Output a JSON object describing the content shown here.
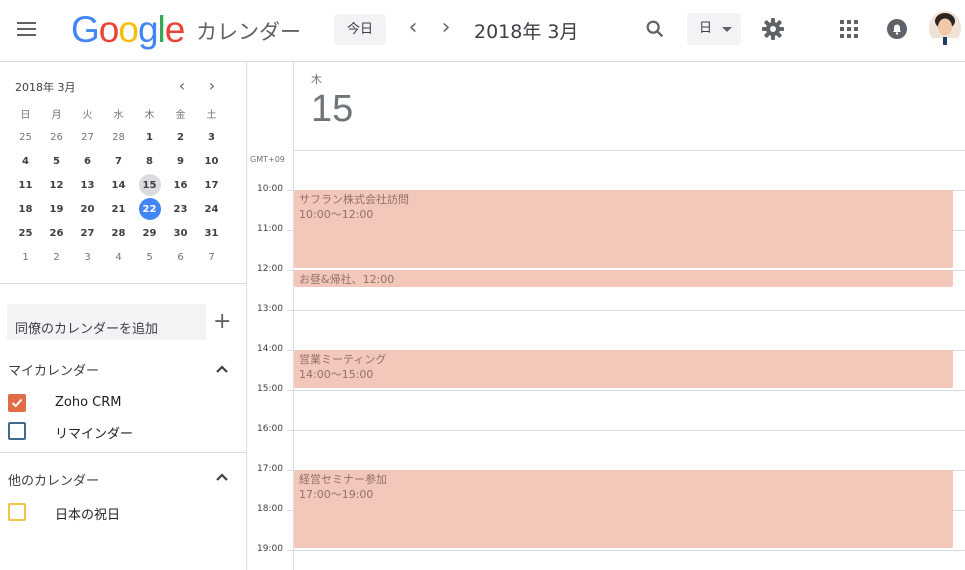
{
  "header": {
    "app_name": "カレンダー",
    "logo_text": "Google",
    "today_button": "今日",
    "current_period": "2018年 3月",
    "view_selector": "日",
    "icons": [
      "menu-icon",
      "chevron-left-icon",
      "chevron-right-icon",
      "search-icon",
      "gear-icon",
      "apps-grid-icon",
      "notifications-icon",
      "avatar"
    ]
  },
  "mini_calendar": {
    "title": "2018年 3月",
    "weekdays": [
      "日",
      "月",
      "火",
      "水",
      "木",
      "金",
      "土"
    ],
    "weeks": [
      [
        "25",
        "26",
        "27",
        "28",
        "1",
        "2",
        "3"
      ],
      [
        "4",
        "5",
        "6",
        "7",
        "8",
        "9",
        "10"
      ],
      [
        "11",
        "12",
        "13",
        "14",
        "15",
        "16",
        "17"
      ],
      [
        "18",
        "19",
        "20",
        "21",
        "22",
        "23",
        "24"
      ],
      [
        "25",
        "26",
        "27",
        "28",
        "29",
        "30",
        "31"
      ],
      [
        "1",
        "2",
        "3",
        "4",
        "5",
        "6",
        "7"
      ]
    ],
    "selected_date": "15",
    "today_date": "22"
  },
  "sidebar": {
    "add_calendar_placeholder": "同僚のカレンダーを追加",
    "my_calendars_title": "マイカレンダー",
    "my_calendars": [
      {
        "label": "Zoho CRM",
        "color": "#e06c47",
        "checked": true
      },
      {
        "label": "リマインダー",
        "color": "#3f6b8f",
        "checked": false
      }
    ],
    "other_calendars_title": "他のカレンダー",
    "other_calendars": [
      {
        "label": "日本の祝日",
        "color": "#f2c34a",
        "checked": false
      }
    ]
  },
  "day_view": {
    "day_of_week": "木",
    "day_number": "15",
    "timezone": "GMT+09",
    "hours": [
      "10:00",
      "11:00",
      "12:00",
      "13:00",
      "14:00",
      "15:00",
      "16:00",
      "17:00",
      "18:00",
      "19:00"
    ],
    "events": [
      {
        "title": "サフラン株式会社訪問",
        "time": "10:00〜12:00"
      },
      {
        "title": "お昼&帰社、12:00",
        "time": ""
      },
      {
        "title": "営業ミーティング",
        "time": "14:00〜15:00"
      },
      {
        "title": "経営セミナー参加",
        "time": "17:00〜19:00"
      }
    ]
  },
  "colors": {
    "accent": "#4285f4",
    "event_bg": "#f4c7bb",
    "event_text": "#93726a"
  }
}
